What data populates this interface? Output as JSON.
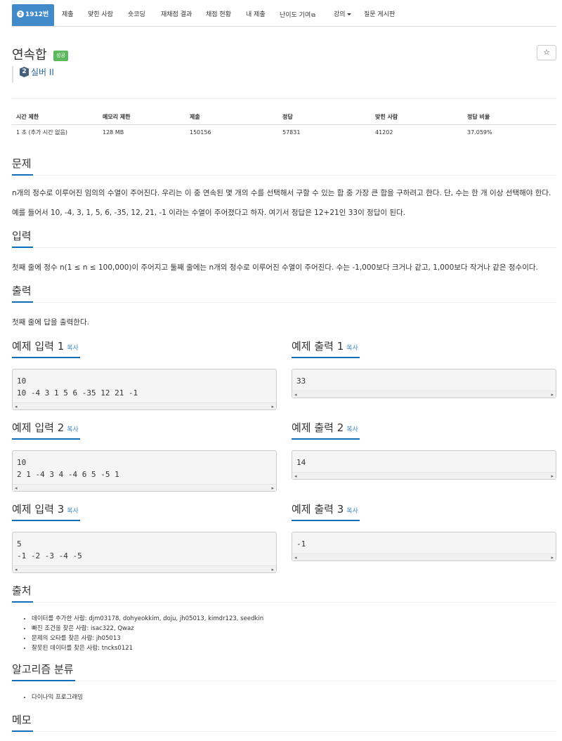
{
  "tabs": {
    "problem_number": "1912번",
    "level_mark": "2",
    "items": [
      "제출",
      "맞힌 사람",
      "숏코딩",
      "재채점 결과",
      "채점 현황",
      "내 제출",
      "난이도 기여",
      "강의",
      "질문 게시판"
    ]
  },
  "problem": {
    "title": "연속합",
    "status_badge": "성공",
    "star": "☆",
    "tier_mark": "2",
    "tier": "실버 II"
  },
  "info_table": {
    "headers": [
      "시간 제한",
      "메모리 제한",
      "제출",
      "정답",
      "맞힌 사람",
      "정답 비율"
    ],
    "values": [
      "1 초 (추가 시간 없음)",
      "128 MB",
      "150156",
      "57831",
      "41202",
      "37.059%"
    ]
  },
  "sections": {
    "problem": {
      "title": "문제",
      "lines": [
        "n개의 정수로 이루어진 임의의 수열이 주어진다. 우리는 이 중 연속된 몇 개의 수를 선택해서 구할 수 있는 합 중 가장 큰 합을 구하려고 한다. 단, 수는 한 개 이상 선택해야 한다.",
        "예를 들어서 10, -4, 3, 1, 5, 6, -35, 12, 21, -1 이라는 수열이 주어졌다고 하자. 여기서 정답은 12+21인 33이 정답이 된다."
      ]
    },
    "input": {
      "title": "입력",
      "text": "첫째 줄에 정수 n(1 ≤ n ≤ 100,000)이 주어지고 둘째 줄에는 n개의 정수로 이루어진 수열이 주어진다. 수는 -1,000보다 크거나 같고, 1,000보다 작거나 같은 정수이다."
    },
    "output": {
      "title": "출력",
      "text": "첫째 줄에 답을 출력한다."
    },
    "source": {
      "title": "출처",
      "items": [
        "데이터를 추가한 사람: djm03178, dohyeokkim, doju, jh05013, kimdr123, seedkin",
        "빠진 조건을 찾은 사람: isac322, Qwaz",
        "문제의 오타를 찾은 사람: jh05013",
        "잘못된 데이터를 찾은 사람: tncks0121"
      ]
    },
    "algorithm": {
      "title": "알고리즘 분류",
      "items": [
        "다이나믹 프로그래밍"
      ]
    },
    "memo": {
      "title": "메모"
    }
  },
  "samples": {
    "copy_label": "복사",
    "items": [
      {
        "input_title": "예제 입력 1",
        "input": "10\n10 -4 3 1 5 6 -35 12 21 -1",
        "output_title": "예제 출력 1",
        "output": "33"
      },
      {
        "input_title": "예제 입력 2",
        "input": "10\n2 1 -4 3 4 -4 6 5 -5 1",
        "output_title": "예제 출력 2",
        "output": "14"
      },
      {
        "input_title": "예제 입력 3",
        "input": "5\n-1 -2 -3 -4 -5",
        "output_title": "예제 출력 3",
        "output": "-1"
      }
    ]
  },
  "icons": {
    "external": "external-link-icon",
    "caret": "caret-down-icon",
    "star": "star-icon",
    "tier": "tier-badge-icon"
  },
  "colors": {
    "primary": "#428bca",
    "success": "#5cb85c",
    "section_underline": "#0e6eb8",
    "tier": "#435f7a"
  }
}
